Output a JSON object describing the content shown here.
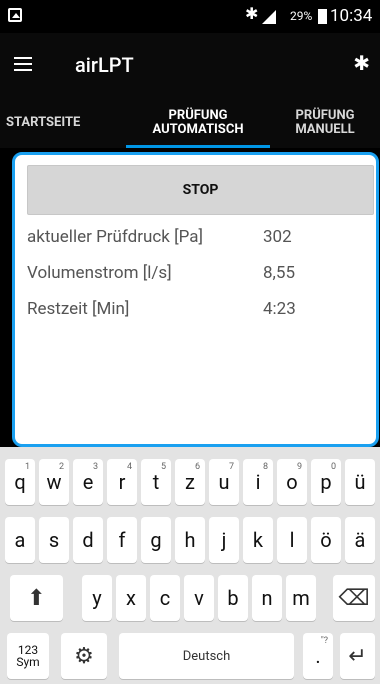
{
  "status_bar": {
    "bluetooth_icon": "bluetooth",
    "signal_icon": "signal",
    "battery_percent": "29%",
    "time": "10:34"
  },
  "app_bar": {
    "title": "airLPT",
    "menu_icon": "menu",
    "right_icon": "bluetooth"
  },
  "tabs": [
    {
      "label": "STARTSEITE"
    },
    {
      "label": "PRÜFUNG AUTOMATISCH"
    },
    {
      "label": "PRÜFUNG MANUELL"
    }
  ],
  "content": {
    "stop_label": "STOP",
    "rows": [
      {
        "label": "aktueller Prüfdruck [Pa]",
        "value": "302"
      },
      {
        "label": "Volumenstrom [l/s]",
        "value": "8,55"
      },
      {
        "label": "Restzeit [Min]",
        "value": "4:23"
      }
    ]
  },
  "keyboard": {
    "row1": [
      "q",
      "w",
      "e",
      "r",
      "t",
      "z",
      "u",
      "i",
      "o",
      "p",
      "ü"
    ],
    "row1_sub": [
      "1",
      "2",
      "3",
      "4",
      "5",
      "6",
      "7",
      "8",
      "9",
      "0",
      ""
    ],
    "row2": [
      "a",
      "s",
      "d",
      "f",
      "g",
      "h",
      "j",
      "k",
      "l",
      "ö",
      "ä"
    ],
    "row3": [
      "y",
      "x",
      "c",
      "v",
      "b",
      "n",
      "m"
    ],
    "space_label": "Deutsch",
    "sym_label_1": "123",
    "sym_label_2": "Sym",
    "punct_sub": "\"?",
    "punct": "."
  }
}
